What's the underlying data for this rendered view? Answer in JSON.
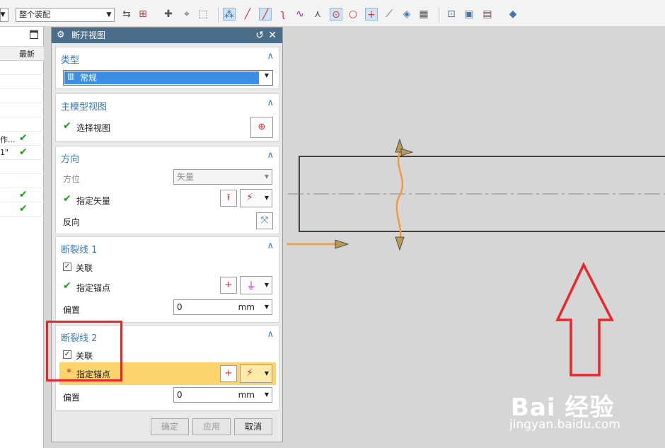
{
  "toolbar": {
    "combo1_value": "",
    "combo2_value": "整个装配",
    "icons": [
      "select-filter-icon",
      "snap-point-icon",
      "endpoint-icon",
      "midpoint-icon",
      "box-select-icon",
      "vertex-snap-icon",
      "line-icon",
      "point-on-curve-icon",
      "curve-icon",
      "spline-icon",
      "intersection-icon",
      "center-icon",
      "circle-icon",
      "cross-icon",
      "vector-icon",
      "view-icon",
      "grid-icon",
      "zoom-icon",
      "render-icon",
      "layer-icon",
      "display-icon"
    ]
  },
  "left_panel": {
    "column_latest": "最新",
    "rows": [
      {
        "text": "",
        "check": false
      },
      {
        "text": "",
        "check": false
      },
      {
        "text": "",
        "check": false
      },
      {
        "text": "",
        "check": false
      },
      {
        "text": "",
        "check": false
      },
      {
        "text": "作...",
        "check": true
      },
      {
        "text": "1\"",
        "check": true
      },
      {
        "text": "",
        "check": false
      },
      {
        "text": "",
        "check": false
      },
      {
        "text": "",
        "check": true
      },
      {
        "text": "",
        "check": true
      }
    ]
  },
  "dialog": {
    "title": "断开视图",
    "type_section": {
      "header": "类型",
      "value": "常规"
    },
    "model_view_section": {
      "header": "主模型视图",
      "select_label": "选择视图"
    },
    "direction_section": {
      "header": "方向",
      "orientation_label": "方位",
      "orientation_value": "矢量",
      "specify_vector_label": "指定矢量",
      "reverse_label": "反向"
    },
    "break_line1": {
      "header": "断裂线 1",
      "associative_label": "关联",
      "anchor_label": "指定锚点",
      "offset_label": "偏置",
      "offset_value": "0",
      "offset_unit": "mm"
    },
    "break_line2": {
      "header": "断裂线 2",
      "associative_label": "关联",
      "anchor_label": "指定锚点",
      "required_mark": "*",
      "offset_label": "偏置",
      "offset_value": "0",
      "offset_unit": "mm"
    },
    "buttons": {
      "ok": "确定",
      "apply": "应用",
      "cancel": "取消"
    }
  },
  "watermark": {
    "brand": "Bai  经验",
    "url": "jingyan.baidu.com"
  },
  "colors": {
    "title_bar": "#4a6e8a",
    "section_header": "#3778b5",
    "highlight_row": "#fcd46b",
    "annotation_red": "#e8262b",
    "break_line": "#f39a3c"
  }
}
